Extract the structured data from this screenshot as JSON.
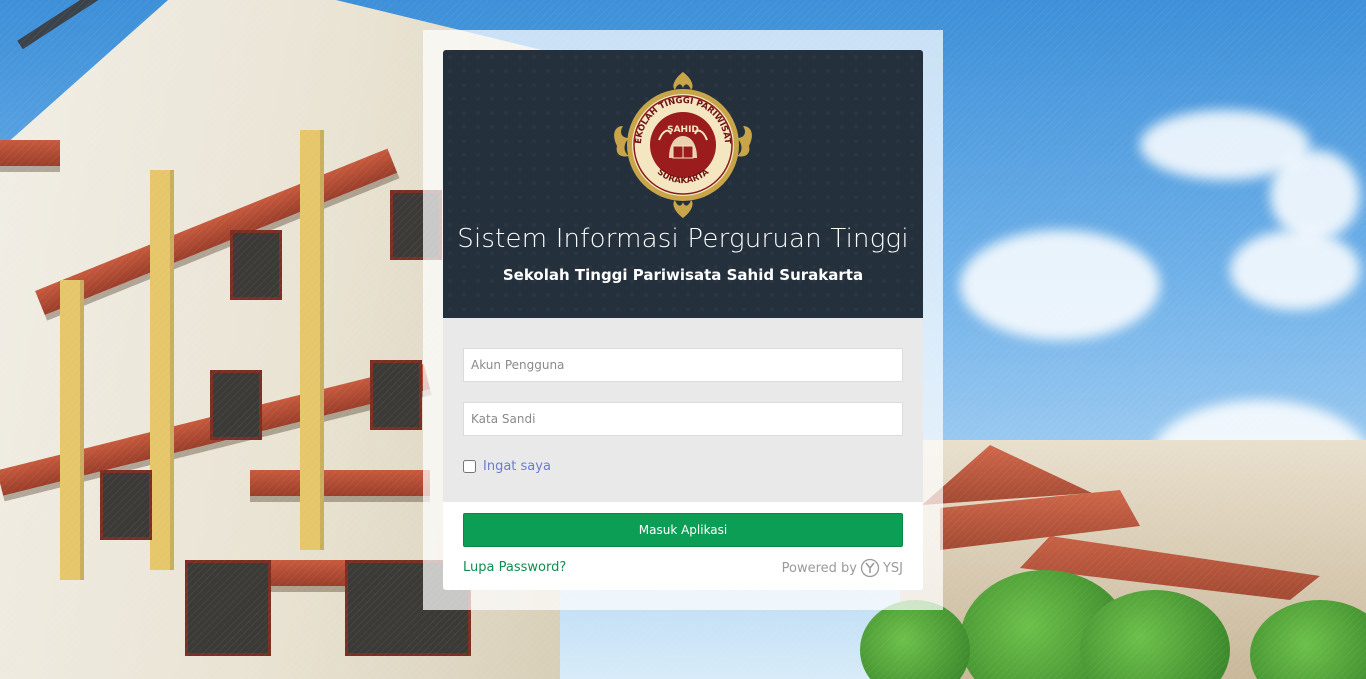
{
  "header": {
    "logo": "stp-sahid-emblem",
    "logo_text_top": "SEKOLAH TINGGI PARIWISATA",
    "logo_text_middle": "SAHID",
    "logo_text_bottom": "SURAKARTA",
    "title": "Sistem Informasi Perguruan Tinggi",
    "subtitle": "Sekolah Tinggi Pariwisata Sahid Surakarta"
  },
  "form": {
    "username_placeholder": "Akun Pengguna",
    "username_value": "",
    "password_placeholder": "Kata Sandi",
    "password_value": "",
    "remember_label": "Ingat saya",
    "remember_checked": false,
    "submit_label": "Masuk Aplikasi",
    "forgot_label": "Lupa Password?"
  },
  "footer": {
    "powered_by_label": "Powered by",
    "powered_logo": "ysj-logo",
    "powered_by_name": "YSJ"
  },
  "colors": {
    "header_bg": "#25303d",
    "body_bg": "#e9e9e9",
    "submit_bg": "#0d9e55",
    "forgot_link": "#0e8e4f",
    "remember_label": "#6c7bd0"
  }
}
